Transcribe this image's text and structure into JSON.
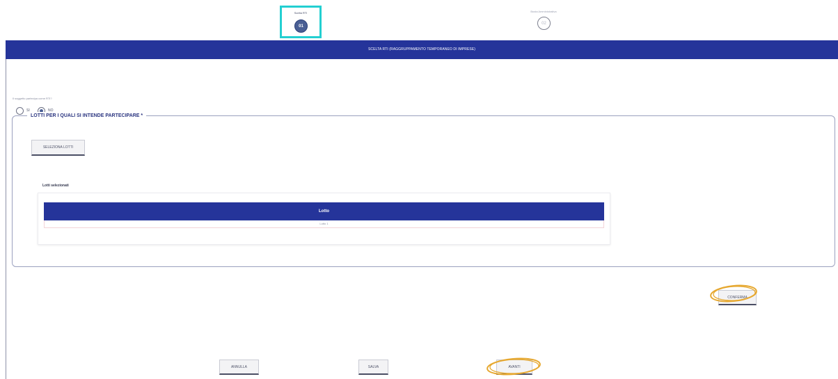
{
  "stepper": {
    "steps": [
      {
        "label": "Scelta RTI",
        "number": "01",
        "state": "active"
      },
      {
        "label": "Busta Amministrativa",
        "number": "02",
        "state": "inactive"
      }
    ]
  },
  "header": {
    "title": "SCELTA RTI (RAGGRUPPAMENTO TEMPORANEO DI IMPRESE)"
  },
  "question": {
    "text": "Il soggetto partecipa come RTI?",
    "options": [
      {
        "label": "SI",
        "checked": false
      },
      {
        "label": "NO",
        "checked": true
      }
    ]
  },
  "lots": {
    "legend": "LOTTI PER I QUALI SI INTENDE PARTECIPARE *",
    "select_button": "SELEZIONA LOTTI",
    "selected_label": "Lotti selezionati",
    "table": {
      "header": "Lotto",
      "rows": [
        "Lotto 1"
      ]
    }
  },
  "actions": {
    "conferma": "CONFERMA",
    "annulla": "ANNULLA",
    "salva": "SALVA",
    "avanti": "AVANTI"
  },
  "colors": {
    "primary": "#25349a",
    "step_active": "#4a5f94",
    "step_highlight": "#23cfd1",
    "annotation": "#e6a830"
  }
}
